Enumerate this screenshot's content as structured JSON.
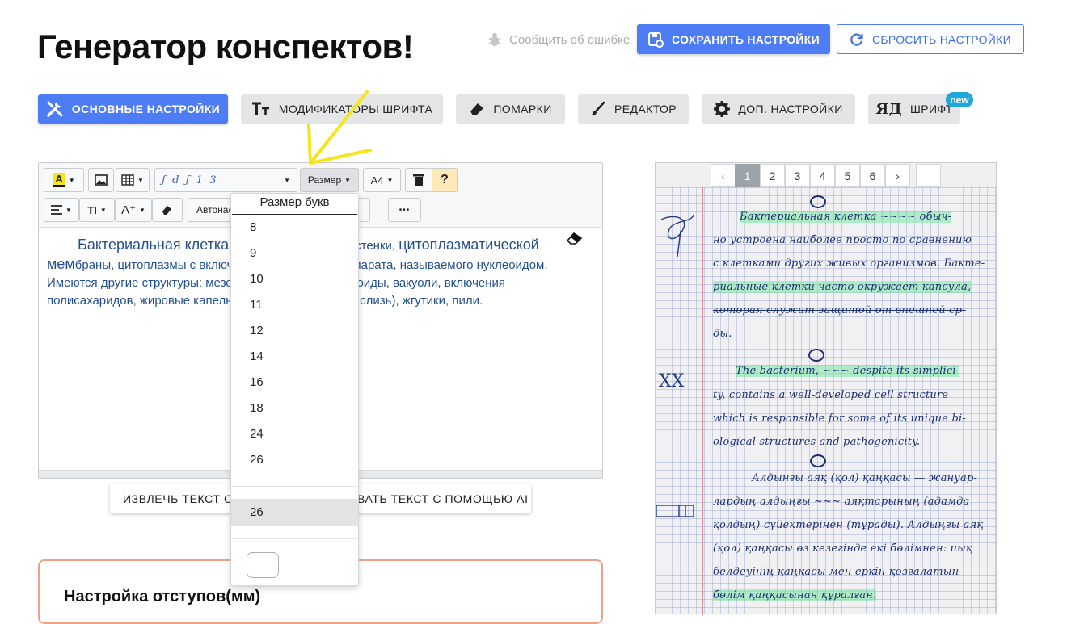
{
  "header": {
    "title_a": "Генератор",
    "title_b": " конспектов!",
    "report_label": "Сообщить об ошибке",
    "save_label": "СОХРАНИТЬ НАСТРОЙКИ",
    "reset_label": "СБРОСИТЬ НАСТРОЙКИ"
  },
  "tabs": [
    {
      "label": "ОСНОВНЫЕ НАСТРОЙКИ",
      "active": true
    },
    {
      "label": "МОДИФИКАТОРЫ ШРИФТА"
    },
    {
      "label": "ПОМАРКИ"
    },
    {
      "label": "РЕДАКТОР"
    },
    {
      "label": "ДОП. НАСТРОЙКИ"
    },
    {
      "label": "ШРИФТ",
      "badge": "new"
    }
  ],
  "toolbar": {
    "font_preview": "ƒ  d  ƒ  1  3",
    "size_label": "Размер",
    "paper_label": "A4",
    "help_label": "?",
    "auto_label": "Автонас",
    "color_glyph": "A",
    "text_glyph": "TI",
    "aplus_glyph": "A⁺",
    "more_glyph": "•••"
  },
  "editor": {
    "line1a": "Бактериальная клетка",
    "line1b": "стенки, ",
    "line1c": "цитоплазматической",
    "line2a": "мем",
    "line2b": "браны, цитоплазмы с включ",
    "line2c": "парата, называемого нуклеоидом.",
    "line3a": "Имеются другие структуры: мезо",
    "line3b": "лакоиды, вакуоли, включения",
    "line4a": "полисахаридов, жировые капель",
    "line4b": "сула, слизь), жгутики, пили."
  },
  "ai_bar": {
    "left_label": "ИЗВЛЕЧЬ ТЕКСТ С С",
    "right_label": "ВАТЬ ТЕКСТ С ПОМОЩЬЮ AI"
  },
  "margins": {
    "title": "Настройка отступов(мм)"
  },
  "size_dropdown": {
    "header": "Размер букв",
    "options": [
      "8",
      "9",
      "10",
      "11",
      "12",
      "14",
      "16",
      "18",
      "24",
      "26"
    ],
    "current": "26"
  },
  "preview": {
    "pages": [
      "‹",
      "1",
      "2",
      "3",
      "4",
      "5",
      "6",
      "›"
    ],
    "active_page": "1",
    "lines": [
      "Бактериальная клетка ~~~~ обыч-",
      "но устроена наиболее просто по сравнению",
      "с клетками других живых организмов. Бакте-",
      "риальные клетки часто окружает капсула,",
      "которая служит защитой от внешней ср-",
      "ды.",
      "The bacterium, ~~~ despite its simplici-",
      "ty, contains a well-developed cell structure",
      "which is responsible for some of its unique bi-",
      "ological structures and pathogenicity.",
      "Алдынғы аяқ (қол) қаңқасы — жануар-",
      "лардың алдыңғы ~~~ аяқтарының (адамда",
      "қолдың) сүйектерінен (тұрады). Алдыңғы аяқ",
      "(қол) қаңқасы өз кезегінде екі бөлімнен: иық",
      "белдеуінің қаңқасы мен еркін қозғалатын",
      "бөлім қаңқасынан құралған."
    ],
    "side_mark": "XX"
  },
  "colors": {
    "primary": "#4e7cf5",
    "badge": "#1ea7d8",
    "ink": "#1c2f72",
    "highlight": "#78e6a0",
    "arrow": "#f5e61a"
  }
}
